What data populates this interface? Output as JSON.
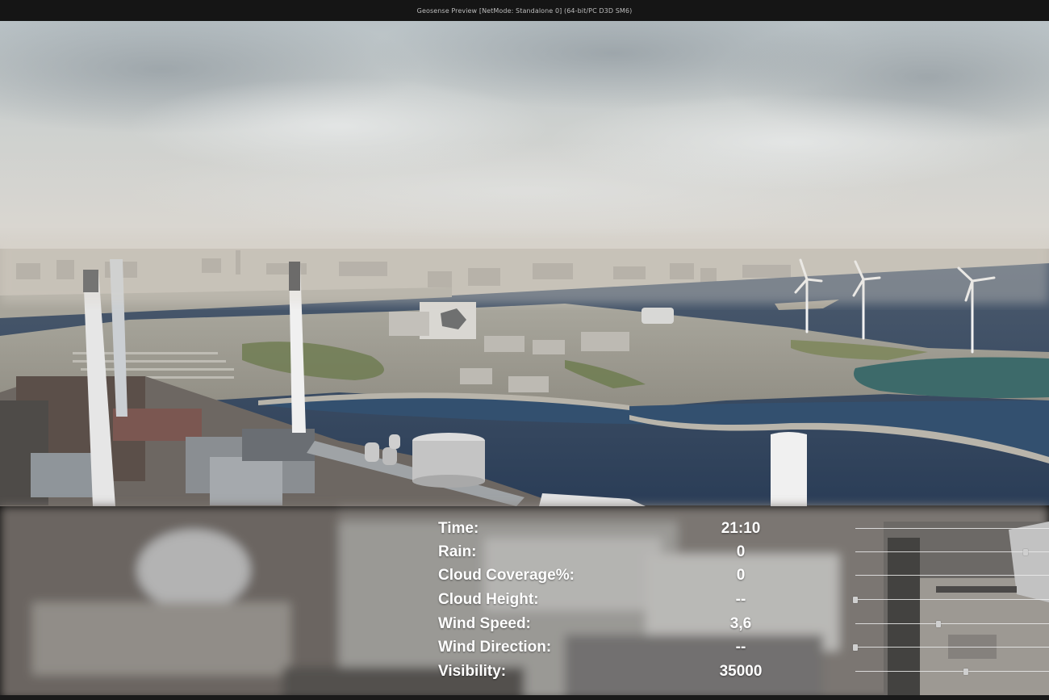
{
  "window": {
    "title": "Geosense Preview [NetMode: Standalone 0]  (64-bit/PC D3D SM6)"
  },
  "controls": [
    {
      "id": "time",
      "label": "Time:",
      "value": "21:10",
      "slider_position": null
    },
    {
      "id": "rain",
      "label": "Rain:",
      "value": "0",
      "slider_position": 0.88
    },
    {
      "id": "cloud-coverage",
      "label": "Cloud Coverage%:",
      "value": "0",
      "slider_position": null
    },
    {
      "id": "cloud-height",
      "label": "Cloud Height:",
      "value": "--",
      "slider_position": 0.0
    },
    {
      "id": "wind-speed",
      "label": "Wind Speed:",
      "value": "3,6",
      "slider_position": 0.43
    },
    {
      "id": "wind-direction",
      "label": "Wind Direction:",
      "value": "--",
      "slider_position": 0.0
    },
    {
      "id": "visibility",
      "label": "Visibility:",
      "value": "35000",
      "slider_position": 0.57
    }
  ],
  "colors": {
    "titlebar": "#151515",
    "label_text": "#ffffff",
    "track": "#ebebeb",
    "thumb": "#cfcfcf"
  }
}
